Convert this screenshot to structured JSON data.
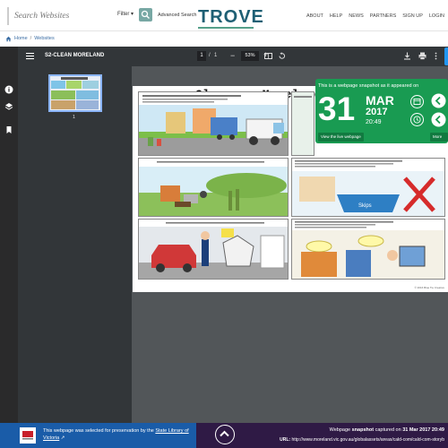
{
  "header": {
    "search_placeholder": "Search Websites",
    "filter_label": "Filter",
    "advanced_search": "Advanced Search",
    "logo": "TROVE",
    "nav": [
      "ABOUT",
      "HELP",
      "NEWS",
      "PARTNERS",
      "SIGN UP",
      "LOGIN"
    ]
  },
  "breadcrumb": {
    "home": "Home",
    "separator": "/",
    "current": "Websites"
  },
  "toolbar": {
    "title": "S2-CLEAN MORELAND",
    "page_current": "1",
    "page_separator": "/",
    "page_total": "1",
    "zoom": "53%"
  },
  "thumbnail": {
    "label": "1"
  },
  "page": {
    "title": "Clean up Moreland",
    "footnote": "© 2016 Blue Tie Creative"
  },
  "snapshot": {
    "heading": "This is a webpage snapshot as it appeared on",
    "day": "31",
    "month": "MAR",
    "year": "2017",
    "time": "20:49",
    "view_live": "View the live webpage",
    "more": "More sn"
  },
  "footer": {
    "selected_text": "This webpage was selected for preservation by the",
    "selected_link": "State Library of Victoria",
    "capture_prefix": "Webpage",
    "capture_bold": "snapshot",
    "capture_middle": "captured on",
    "capture_date": "31 Mar 2017 20:49",
    "url_label": "URL:",
    "url": "http://www.moreland.vic.gov.au/globalassets/areas/cald-com/cald-com-storyb"
  },
  "colors": {
    "brand_teal": "#1e5f74",
    "snapshot_green": "#199b52",
    "footer_blue": "#1a5ca8",
    "footer_purple": "#2f1a45",
    "accent_blue": "#2196f3"
  }
}
